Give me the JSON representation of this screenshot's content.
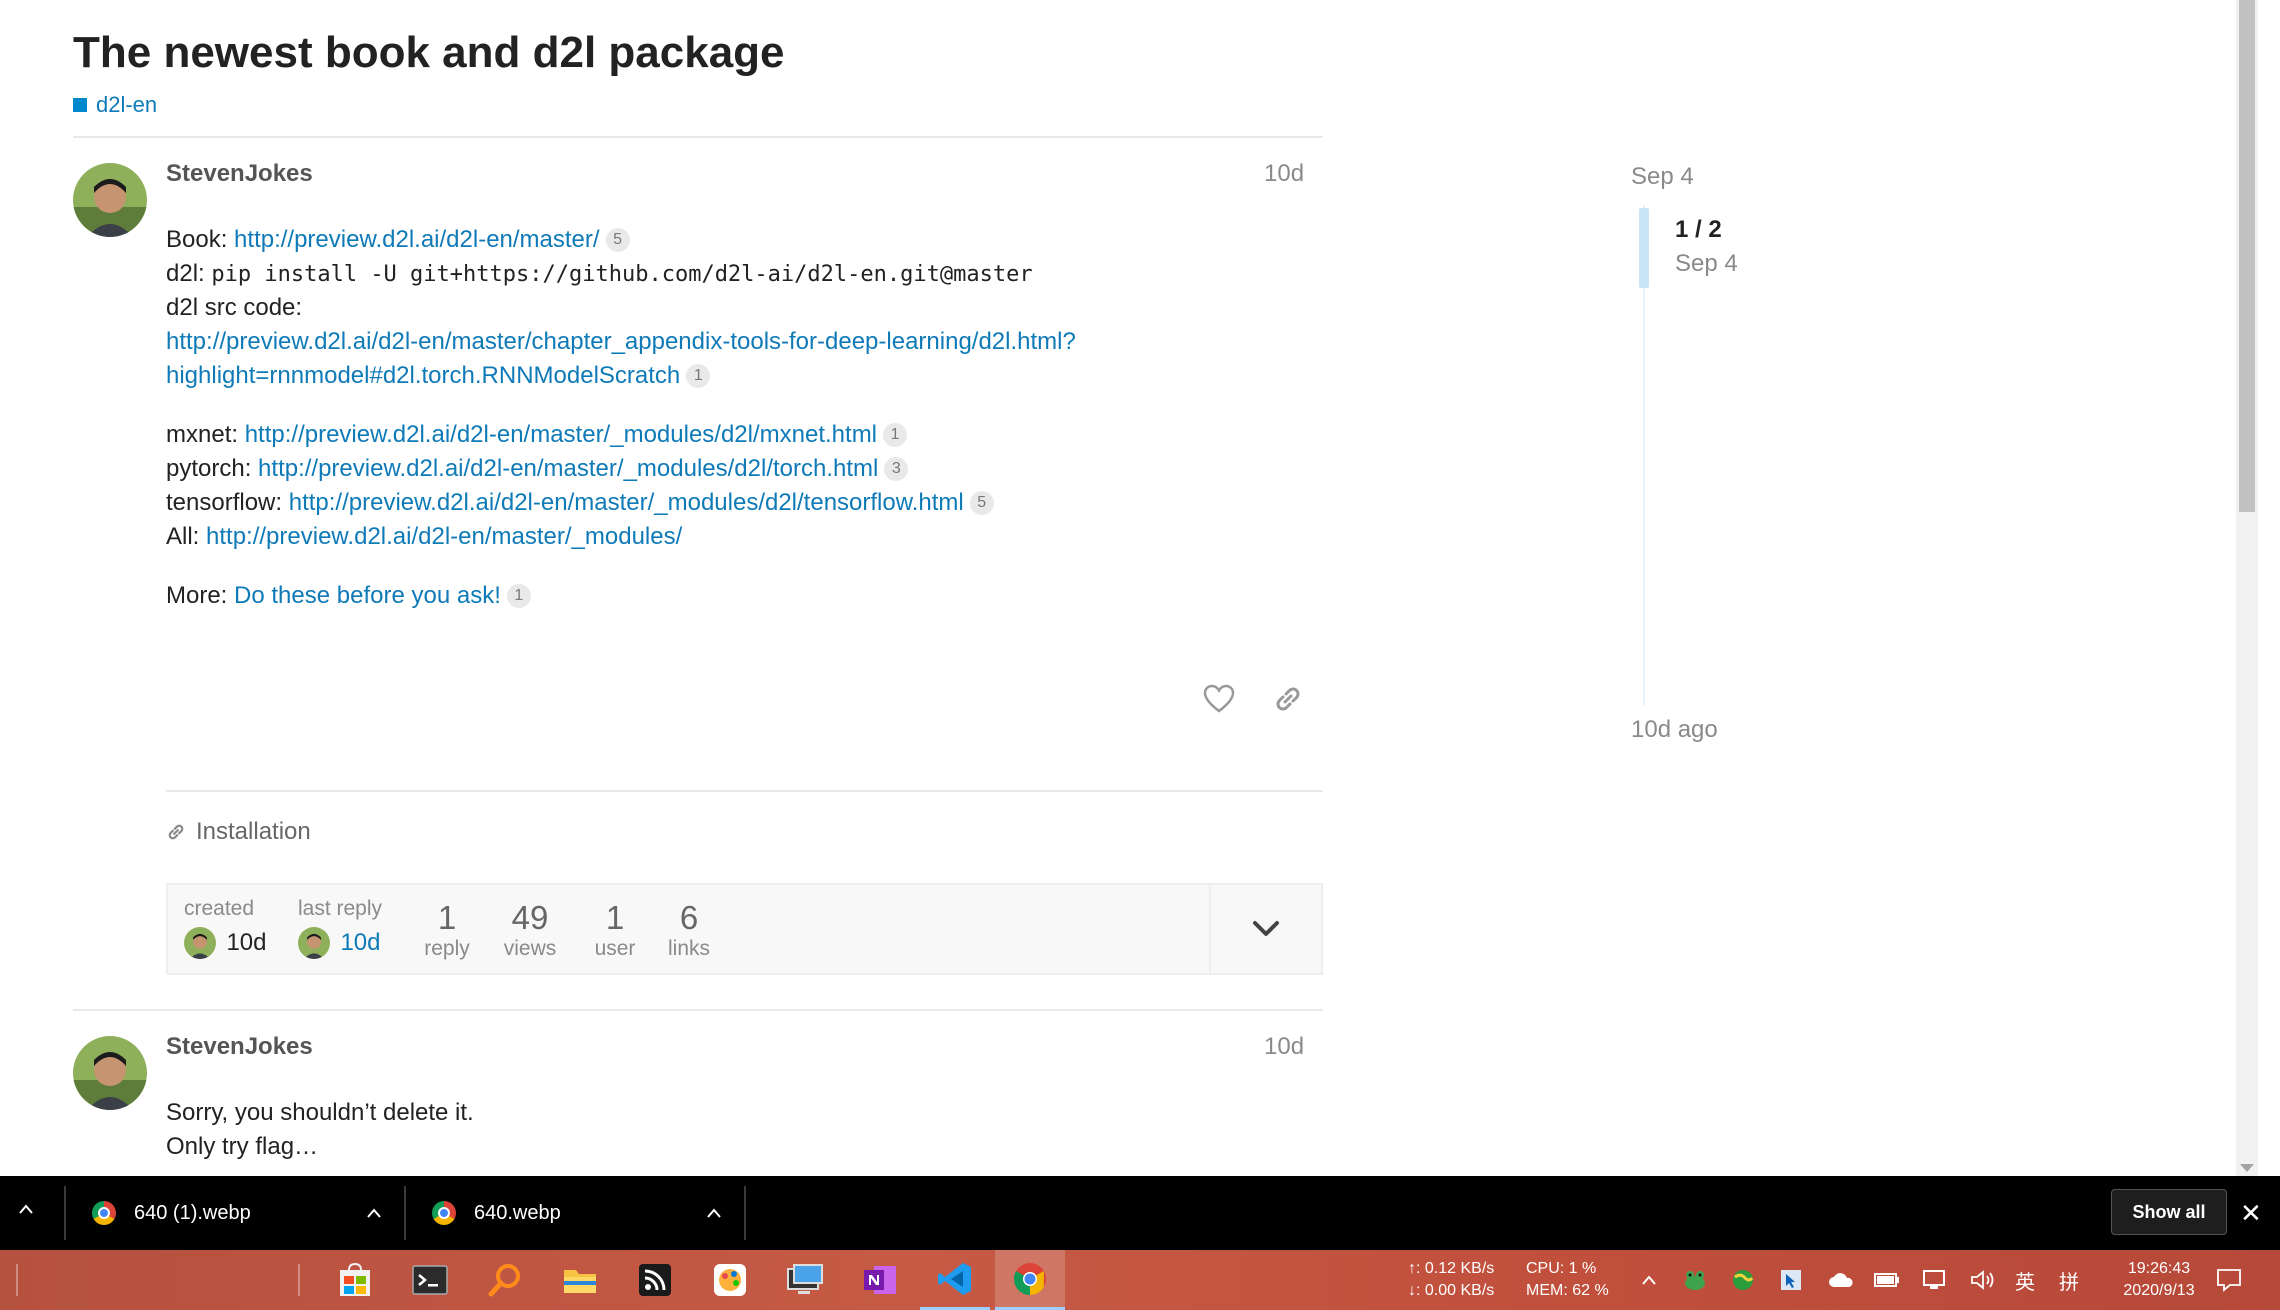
{
  "topic": {
    "title": "The newest book and d2l package",
    "category": "d2l-en"
  },
  "post1": {
    "username": "StevenJokes",
    "date": "10d",
    "book_label": "Book:",
    "book_url": "http://preview.d2l.ai/d2l-en/master/",
    "book_clicks": "5",
    "d2l_label": "d2l:",
    "d2l_cmd": "pip install -U git+https://github.com/d2l-ai/d2l-en.git@master",
    "src_label": "d2l src code:",
    "src_url_line1": "http://preview.d2l.ai/d2l-en/master/chapter_appendix-tools-for-deep-learning/d2l.html?",
    "src_url_line2": "highlight=rnnmodel#d2l.torch.RNNModelScratch",
    "src_clicks": "1",
    "mxnet_label": "mxnet:",
    "mxnet_url": "http://preview.d2l.ai/d2l-en/master/_modules/d2l/mxnet.html",
    "mxnet_clicks": "1",
    "pytorch_label": "pytorch:",
    "pytorch_url": "http://preview.d2l.ai/d2l-en/master/_modules/d2l/torch.html",
    "pytorch_clicks": "3",
    "tensorflow_label": "tensorflow:",
    "tensorflow_url": "http://preview.d2l.ai/d2l-en/master/_modules/d2l/tensorflow.html",
    "tensorflow_clicks": "5",
    "all_label": "All:",
    "all_url": "http://preview.d2l.ai/d2l-en/master/_modules/",
    "more_label": "More:",
    "more_link": "Do these before you ask!",
    "more_clicks": "1"
  },
  "linked_topic": "Installation",
  "topic_map": {
    "created_label": "created",
    "created_value": "10d",
    "last_reply_label": "last reply",
    "last_reply_value": "10d",
    "replies_num": "1",
    "replies_label": "reply",
    "views_num": "49",
    "views_label": "views",
    "users_num": "1",
    "users_label": "user",
    "links_num": "6",
    "links_label": "links"
  },
  "post2": {
    "username": "StevenJokes",
    "date": "10d",
    "line1": "Sorry, you shouldn’t delete it.",
    "line2": "Only try flag…"
  },
  "timeline": {
    "start": "Sep 4",
    "position": "1 / 2",
    "position_date": "Sep 4",
    "end": "10d ago"
  },
  "downloads": {
    "items": [
      "640 (1).webp",
      "640.webp"
    ],
    "show_all": "Show all"
  },
  "taskbar": {
    "apps": [
      "store-icon",
      "terminal-icon",
      "search-app-icon",
      "file-explorer-icon",
      "rss-icon",
      "paint-icon",
      "remote-desktop-icon",
      "onenote-icon",
      "vscode-icon",
      "chrome-icon"
    ],
    "net_up": "↑: 0.12 KB/s",
    "net_down": "↓: 0.00 KB/s",
    "cpu": "CPU:   1 %",
    "mem": "MEM: 62 %",
    "ime_lang": "英",
    "ime_mode": "拼",
    "time": "19:26:43",
    "date": "2020/9/13"
  },
  "colors": {
    "link": "#0f7ab8",
    "category": "#0088cc",
    "taskbar": "#c65a45"
  }
}
